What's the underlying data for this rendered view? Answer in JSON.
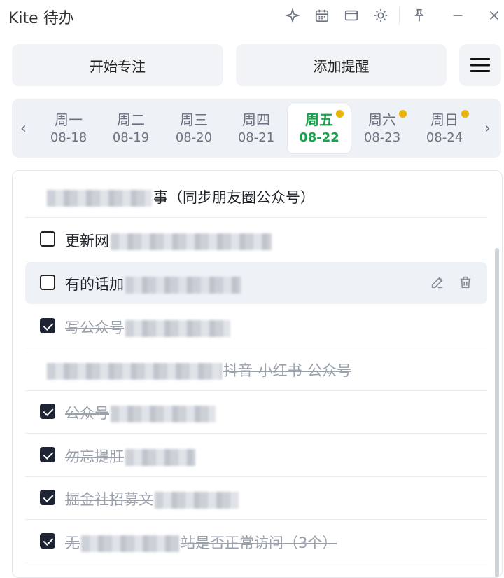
{
  "app": {
    "title": "Kite 待办"
  },
  "titlebar_icons": [
    "sparkle-icon",
    "calendar-icon",
    "window-icon",
    "sun-icon",
    "pin-icon",
    "minimize-icon",
    "close-icon"
  ],
  "actions": {
    "focus_label": "开始专注",
    "reminder_label": "添加提醒"
  },
  "week": {
    "days": [
      {
        "weekday": "周一",
        "date": "08-18",
        "active": false,
        "dot": false
      },
      {
        "weekday": "周二",
        "date": "08-19",
        "active": false,
        "dot": false
      },
      {
        "weekday": "周三",
        "date": "08-20",
        "active": false,
        "dot": false
      },
      {
        "weekday": "周四",
        "date": "08-21",
        "active": false,
        "dot": false
      },
      {
        "weekday": "周五",
        "date": "08-22",
        "active": true,
        "dot": true
      },
      {
        "weekday": "周六",
        "date": "08-23",
        "active": false,
        "dot": true
      },
      {
        "weekday": "周日",
        "date": "08-24",
        "active": false,
        "dot": true
      }
    ],
    "prev": "‹",
    "next": "›"
  },
  "tasks": [
    {
      "text_pre": "",
      "text_post": "事（同步朋友圈公众号）",
      "done": false,
      "checkbox": false
    },
    {
      "text_pre": "更新网",
      "text_post": "",
      "done": false,
      "checkbox": true
    },
    {
      "text_pre": "有的话加",
      "text_post": "",
      "done": false,
      "checkbox": true,
      "hover": true
    },
    {
      "text_pre": "写公众号",
      "text_post": "",
      "done": true,
      "checkbox": true
    },
    {
      "text_pre": "",
      "text_post": "抖音-小红书-公众号",
      "done": true,
      "checkbox": false
    },
    {
      "text_pre": "公众号",
      "text_post": "",
      "done": true,
      "checkbox": true
    },
    {
      "text_pre": "勿忘提肛",
      "text_post": "",
      "done": true,
      "checkbox": true
    },
    {
      "text_pre": "掘金社招募文",
      "text_post": "",
      "done": true,
      "checkbox": true
    },
    {
      "text_pre": "无",
      "text_post": "站是否正常访问（3个）",
      "done": true,
      "checkbox": true
    }
  ],
  "colors": {
    "accent": "#16a34a",
    "dot": "#eab308",
    "checked": "#1e2433"
  }
}
